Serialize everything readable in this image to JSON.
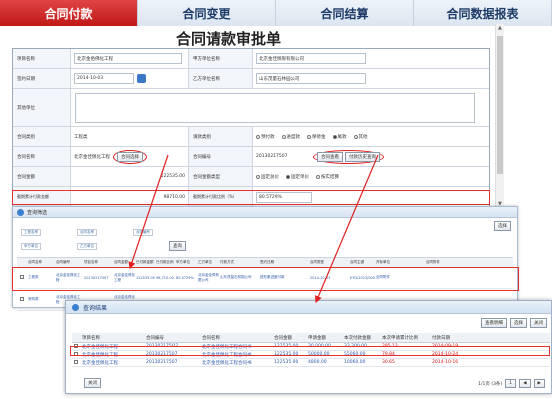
{
  "tabs": [
    "合同付款",
    "合同变更",
    "合同结算",
    "合同数据报表"
  ],
  "page_title": "合同请款审批单",
  "form": {
    "project_name": {
      "label": "项目名称",
      "value": "北京金俗佛化工程"
    },
    "party_a": {
      "label": "甲方单位名称",
      "value": "北京金佳佩限有限公司"
    },
    "sign_date": {
      "label": "签约日期",
      "value": "2014-10-03"
    },
    "party_b": {
      "label": "乙方单位名称",
      "value": "山东茂量石林园公司"
    },
    "other_unit": {
      "label": "其他单位",
      "value": ""
    },
    "contract_type": {
      "label": "合同类别",
      "value": "工程类"
    },
    "pay_type": {
      "label": "请款类别",
      "options": [
        "预付款",
        "进度款",
        "保修金",
        "尾款",
        "其他"
      ],
      "selected": 3
    },
    "contract_name": {
      "label": "合同名称",
      "value": "北京金佳佩化工程",
      "btn": "合同选择"
    },
    "contract_no": {
      "label": "合同编号",
      "value": "20130217507",
      "btn1": "合同查看",
      "btn2": "付款历史查询"
    },
    "contract_amount": {
      "label": "合同金额",
      "value": "122535.00"
    },
    "amount_type": {
      "label": "合同金额类型",
      "options": [
        "固定总价",
        "固定单价",
        "按实结算"
      ],
      "selected": 1
    },
    "prev_paid": {
      "label": "截期累计付款金额",
      "value": "98710.00"
    },
    "prev_ratio": {
      "label": "截期累计付款比例（%）",
      "value": "80.5729%"
    }
  },
  "dialog1": {
    "title": "查询筛选",
    "close_btn": "选择",
    "query_btn": "查询",
    "filters": [
      "工程名称",
      "合同名称",
      "合同编号",
      "甲方单位",
      "乙方单位"
    ],
    "columns": [
      "",
      "合同名称",
      "合同编号",
      "项目名称",
      "合同金额",
      "已付款金额",
      "已付款比例",
      "甲方单位",
      "乙方单位",
      "付款方式",
      "签约日期",
      "合同类型",
      "合同主键",
      "开标单位",
      "合同附件"
    ],
    "rows": [
      [
        "工程类",
        "北京金佳佩化工程",
        "20130217507",
        "北京金佳佩化工程",
        "122535.00",
        "98,710.00",
        "80.5729%",
        "北京金佳佩有限公司",
        "山东茂量石林园公司",
        "按形象进度付款",
        "2014-10-03",
        "EYG/2013/0001",
        "合同附件"
      ],
      [
        "采购类",
        "北京金佳佩化工程",
        "",
        "北京金佳佩化工程"
      ],
      [
        "采购类",
        "合同名称",
        "",
        "合同名称"
      ]
    ]
  },
  "dialog2": {
    "title": "查询结果",
    "buttons": [
      "查看明细",
      "选择",
      "关闭"
    ],
    "columns": [
      "",
      "项目名称",
      "合同编号",
      "合同名称",
      "合同金额",
      "申请金额",
      "本次付款金额",
      "本次申请累计比例",
      "付款日期"
    ],
    "rows": [
      [
        "北京金佳佩化工程",
        "201302175O7",
        "北京金佳佩化工程合同书",
        "122535.00",
        "30,000.00",
        "33,200.00",
        "295.13",
        "2014-09-19"
      ],
      [
        "北京金佳佩化工程",
        "20130217507",
        "北京金佳佩化工程合同书",
        "122535.00",
        "50000.00",
        "55060.00",
        "79.84",
        "2014-10-24"
      ],
      [
        "北京金佳佩化工程",
        "20130217507",
        "北京金佳佩化工程合同书",
        "122535.00",
        "4800.00",
        "10060.00",
        "30.65",
        "2014-10-16"
      ]
    ],
    "pager": "1/1页 (3条)",
    "page_input": "1",
    "footer_btn": "关闭"
  },
  "colors": {
    "accent": "#c01818",
    "highlight": "#e53030",
    "link": "#2c5aa8"
  }
}
